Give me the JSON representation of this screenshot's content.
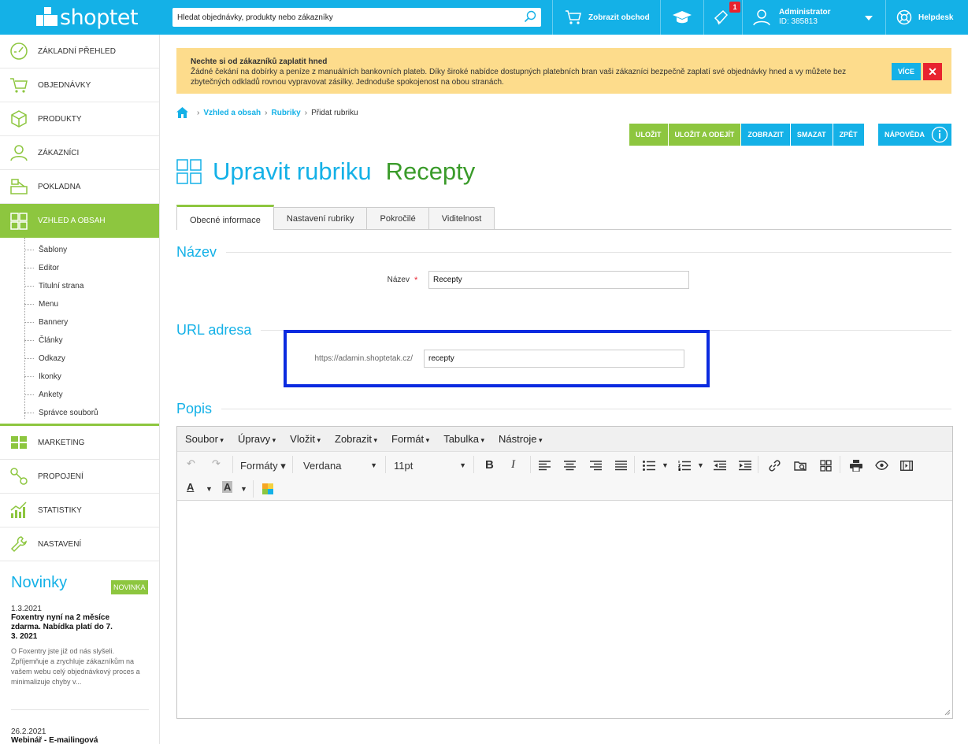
{
  "topbar": {
    "logo_text": "shoptet",
    "search_placeholder": "Hledat objednávky, produkty nebo zákazníky",
    "show_shop": "Zobrazit obchod",
    "notifications_count": "1",
    "admin_name": "Administrator",
    "admin_id": "ID: 385813",
    "helpdesk": "Helpdesk"
  },
  "sidebar": {
    "items": [
      {
        "label": "ZÁKLADNÍ PŘEHLED",
        "icon": "speedometer-icon"
      },
      {
        "label": "OBJEDNÁVKY",
        "icon": "cart-icon"
      },
      {
        "label": "PRODUKTY",
        "icon": "box-icon"
      },
      {
        "label": "ZÁKAZNÍCI",
        "icon": "user-icon"
      },
      {
        "label": "POKLADNA",
        "icon": "register-icon"
      },
      {
        "label": "VZHLED A OBSAH",
        "icon": "layout-icon"
      }
    ],
    "subitems": [
      "Šablony",
      "Editor",
      "Titulní strana",
      "Menu",
      "Bannery",
      "Články",
      "Odkazy",
      "Ikonky",
      "Ankety",
      "Správce souborů"
    ],
    "items2": [
      {
        "label": "MARKETING",
        "icon": "marketing-icon"
      },
      {
        "label": "PROPOJENÍ",
        "icon": "connect-icon"
      },
      {
        "label": "STATISTIKY",
        "icon": "stats-icon"
      },
      {
        "label": "NASTAVENÍ",
        "icon": "wrench-icon"
      }
    ]
  },
  "news": {
    "heading": "Novinky",
    "items": [
      {
        "date": "1.3.2021",
        "title": "Foxentry nyní na 2 měsíce zdarma. Nabídka platí do 7. 3. 2021",
        "tag": "NOVINKA",
        "body": "O Foxentry jste již od nás slyšeli. Zpříjemňuje a zrychluje zákazníkům na vašem webu celý objednávkový proces a minimalizuje chyby v..."
      },
      {
        "date": "26.2.2021",
        "title": "Webinář - E-mailingová"
      }
    ]
  },
  "banner": {
    "title": "Nechte si od zákazníků zaplatit hned",
    "text": "Žádné čekání na dobírky a peníze z manuálních bankovních plateb. Díky široké nabídce dostupných platebních bran vaši zákazníci bezpečně zaplatí své objednávky hned a vy můžete bez zbytečných odkladů rovnou vypravovat zásilky. Jednoduše spokojenost na obou stranách.",
    "more": "VÍCE",
    "close": "✕"
  },
  "breadcrumb": {
    "items": [
      "Vzhled a obsah",
      "Rubriky"
    ],
    "current": "Přidat rubriku"
  },
  "actions": {
    "save": "ULOŽIT",
    "save_exit": "ULOŽIT A ODEJÍT",
    "show": "ZOBRAZIT",
    "delete": "SMAZAT",
    "back": "ZPĚT",
    "help": "NÁPOVĚDA"
  },
  "page": {
    "title": "Upravit rubriku",
    "name": "Recepty"
  },
  "tabs": [
    "Obecné informace",
    "Nastavení rubriky",
    "Pokročilé",
    "Viditelnost"
  ],
  "form": {
    "section_name": "Název",
    "name_label": "Název",
    "name_required": "*",
    "name_value": "Recepty",
    "section_url": "URL adresa",
    "url_prefix": "https://adamin.shoptetak.cz/",
    "url_value": "recepty",
    "section_desc": "Popis"
  },
  "editor": {
    "menus": [
      "Soubor",
      "Úpravy",
      "Vložit",
      "Zobrazit",
      "Formát",
      "Tabulka",
      "Nástroje"
    ],
    "formats": "Formáty",
    "font": "Verdana",
    "size": "11pt"
  },
  "colors": {
    "accent": "#14b1e7",
    "green": "#8dc63f",
    "title_green": "#3a9b2a",
    "alert": "#fddc8c",
    "danger": "#e8232f",
    "highlight": "#0b2be0"
  }
}
